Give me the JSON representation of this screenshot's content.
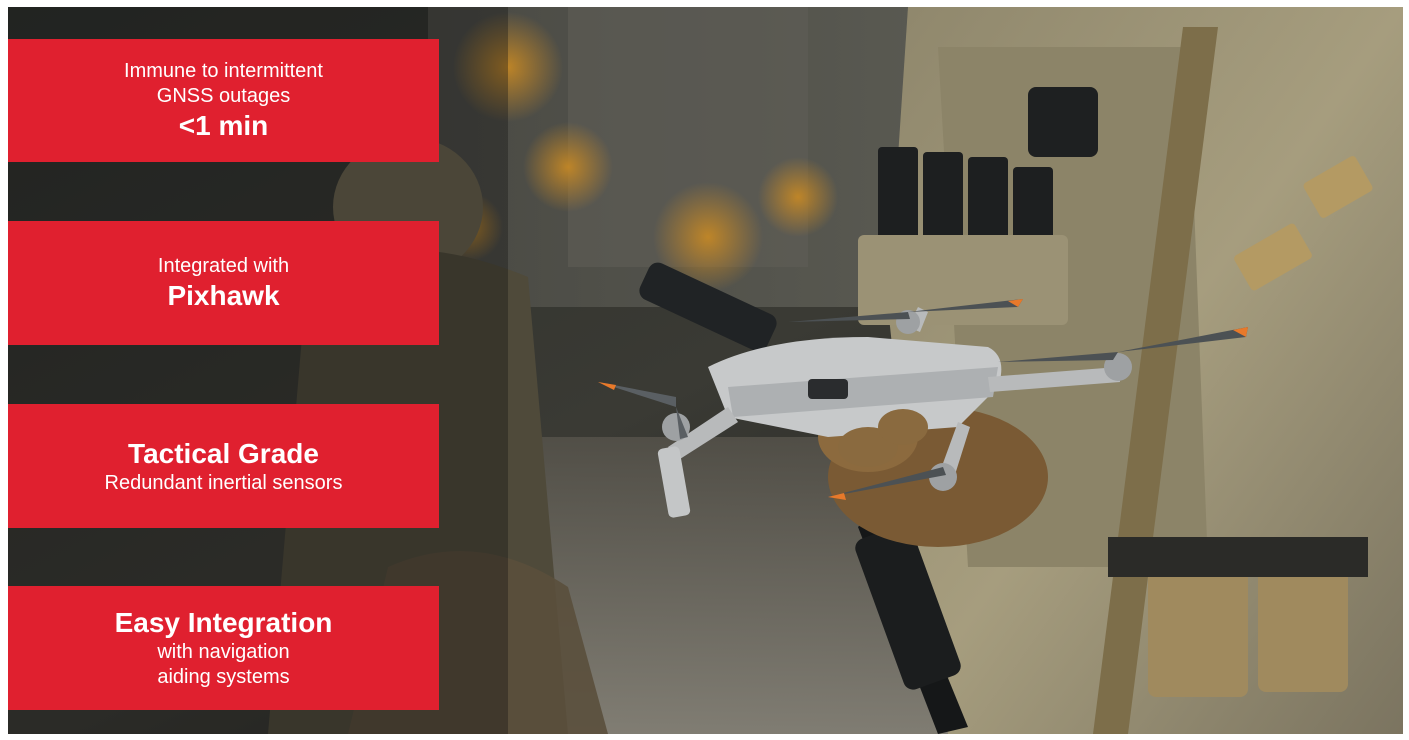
{
  "tiles": [
    {
      "lines": [
        "Immune to intermittent",
        "GNSS outages"
      ],
      "highlight": "<1 min"
    },
    {
      "lines": [
        "Integrated with"
      ],
      "highlight": "Pixhawk"
    },
    {
      "highlight": "Tactical Grade",
      "lines": [
        "Redundant inertial sensors"
      ]
    },
    {
      "highlight": "Easy Integration",
      "lines": [
        "with navigation",
        "aiding systems"
      ]
    }
  ],
  "colors": {
    "tile_background": "#e0202f",
    "tile_text": "#ffffff"
  }
}
